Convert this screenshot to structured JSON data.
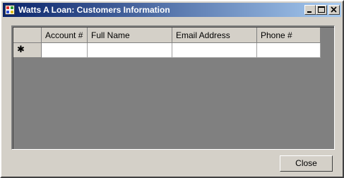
{
  "window": {
    "title": "Watts A Loan: Customers Information",
    "title_bar_color": "#0a246a",
    "face_color": "#d4d0c8"
  },
  "title_buttons": {
    "minimize_icon": "minimize-icon",
    "maximize_icon": "maximize-icon",
    "close_icon": "close-icon"
  },
  "grid": {
    "background_color": "#808080",
    "columns": [
      "Account #",
      "Full Name",
      "Email Address",
      "Phone #"
    ],
    "new_row_marker": "✱",
    "rows": [
      [
        "",
        "",
        "",
        ""
      ]
    ]
  },
  "footer": {
    "close_label": "Close"
  }
}
